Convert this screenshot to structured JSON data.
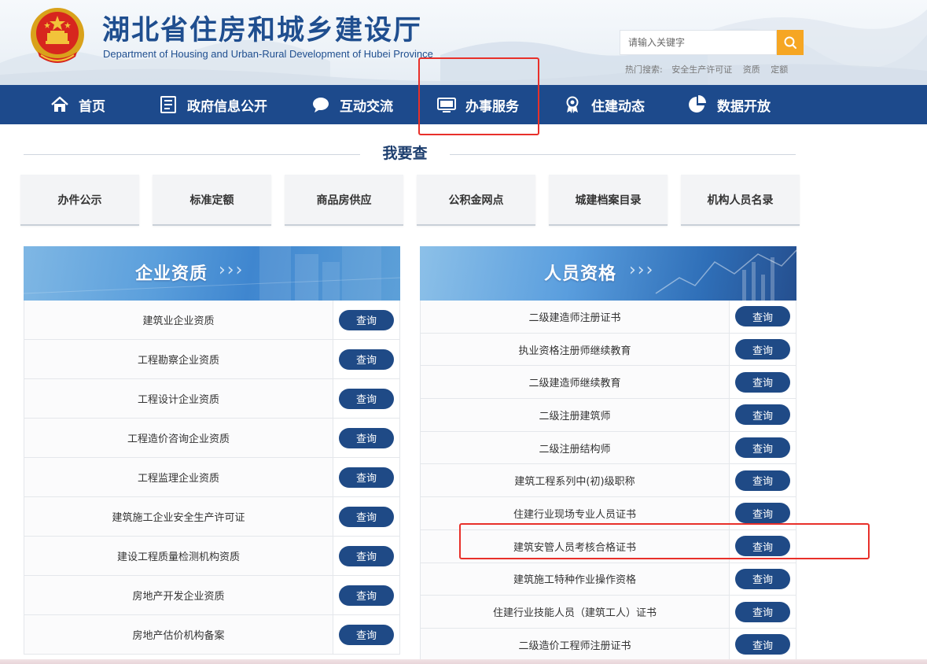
{
  "header": {
    "title": "湖北省住房和城乡建设厅",
    "subtitle": "Department of Housing and Urban-Rural Development of Hubei Province",
    "search_placeholder": "请输入关键字",
    "hot_label": "热门搜索:",
    "hot_items": [
      "安全生产许可证",
      "资质",
      "定额"
    ]
  },
  "nav": {
    "items": [
      {
        "label": "首页",
        "icon": "home-icon"
      },
      {
        "label": "政府信息公开",
        "icon": "document-icon"
      },
      {
        "label": "互动交流",
        "icon": "chat-icon"
      },
      {
        "label": "办事服务",
        "icon": "monitor-icon"
      },
      {
        "label": "住建动态",
        "icon": "award-icon"
      },
      {
        "label": "数据开放",
        "icon": "pie-chart-icon"
      }
    ]
  },
  "section": {
    "title": "我要查",
    "quick_links": [
      "办件公示",
      "标准定额",
      "商品房供应",
      "公积金网点",
      "城建档案目录",
      "机构人员名录"
    ]
  },
  "panels": {
    "left": {
      "title": "企业资质",
      "arrows": "›››",
      "button_label": "查询",
      "rows": [
        "建筑业企业资质",
        "工程勘察企业资质",
        "工程设计企业资质",
        "工程造价咨询企业资质",
        "工程监理企业资质",
        "建筑施工企业安全生产许可证",
        "建设工程质量检测机构资质",
        "房地产开发企业资质",
        "房地产估价机构备案"
      ]
    },
    "right": {
      "title": "人员资格",
      "arrows": "›››",
      "button_label": "查询",
      "rows": [
        "二级建造师注册证书",
        "执业资格注册师继续教育",
        "二级建造师继续教育",
        "二级注册建筑师",
        "二级注册结构师",
        "建筑工程系列中(初)级职称",
        "住建行业现场专业人员证书",
        "建筑安管人员考核合格证书",
        "建筑施工特种作业操作资格",
        "住建行业技能人员（建筑工人）证书",
        "二级造价工程师注册证书"
      ]
    }
  },
  "colors": {
    "nav_bg": "#1d4a8c",
    "title": "#1f4e8f",
    "search_button": "#f6a623",
    "query_button": "#1f4a86",
    "highlight": "#e8302a"
  }
}
